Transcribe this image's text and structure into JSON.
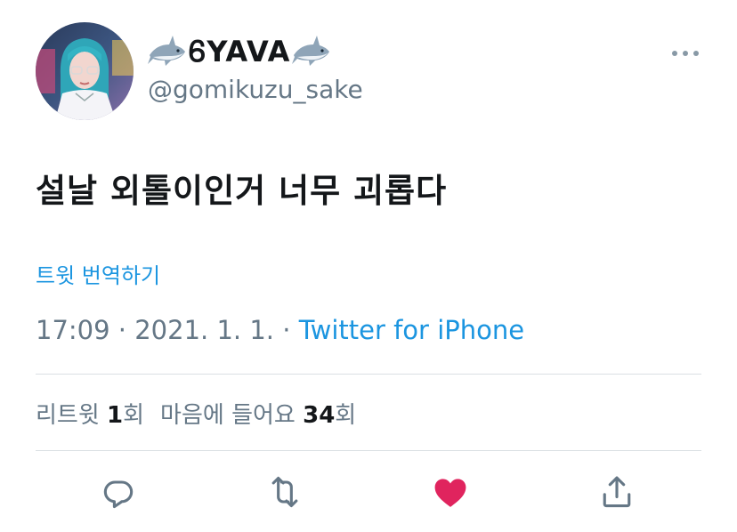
{
  "tweet": {
    "display_name": "ᏮYAVA",
    "handle": "@gomikuzu_sake",
    "text": "설날 외톨이인거 너무 괴롭다",
    "translate_label": "트윗 번역하기",
    "time": "17:09",
    "date": "2021. 1. 1.",
    "separator": "·",
    "source": "Twitter for iPhone",
    "retweets_prefix": "리트윗",
    "retweets_count": "1",
    "retweets_suffix": "회",
    "likes_prefix": "마음에 들어요",
    "likes_count": "34",
    "likes_suffix": "회"
  },
  "icons": {
    "display_name_decoration": "shark-emoji-icon",
    "more": "more-options-icon",
    "reply": "reply-icon",
    "retweet": "retweet-icon",
    "like": "heart-icon",
    "share": "share-icon"
  },
  "colors": {
    "link": "#1b95e0",
    "secondary_text": "#657786",
    "like_active": "#e0245e",
    "action_icon": "#657786"
  },
  "state": {
    "liked": true
  }
}
